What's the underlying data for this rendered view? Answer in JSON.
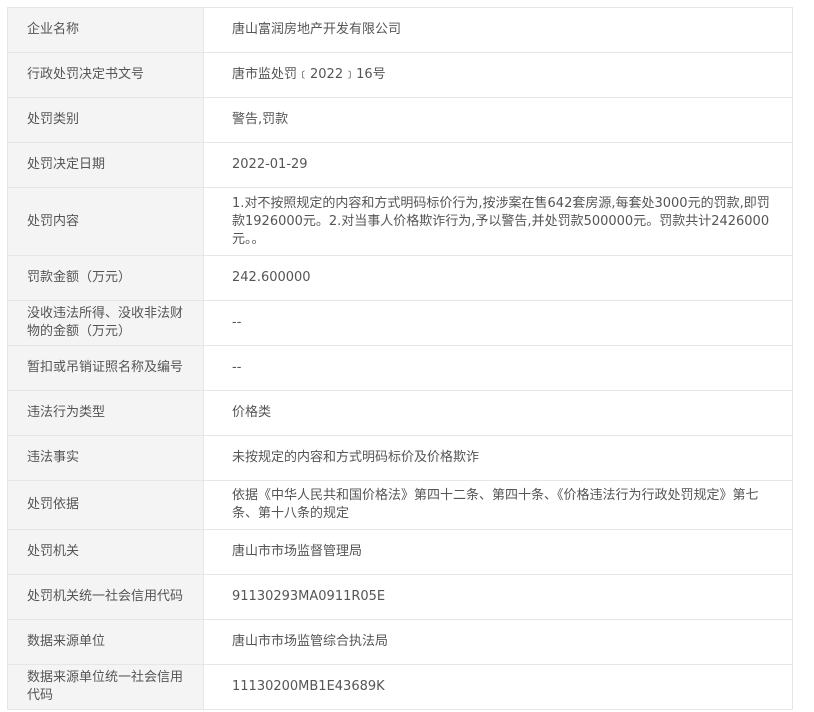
{
  "rows": [
    {
      "label": "企业名称",
      "value": "唐山富润房地产开发有限公司"
    },
    {
      "label": "行政处罚决定书文号",
      "value": "唐市监处罚﹝2022﹞16号"
    },
    {
      "label": "处罚类别",
      "value": "警告,罚款"
    },
    {
      "label": "处罚决定日期",
      "value": "2022-01-29"
    },
    {
      "label": "处罚内容",
      "value": "1.对不按照规定的内容和方式明码标价行为,按涉案在售642套房源,每套处3000元的罚款,即罚款1926000元。2.对当事人价格欺诈行为,予以警告,并处罚款500000元。罚款共计2426000元。。"
    },
    {
      "label": "罚款金额（万元）",
      "value": "242.600000"
    },
    {
      "label": "没收违法所得、没收非法财物的金额（万元）",
      "value": "--"
    },
    {
      "label": "暂扣或吊销证照名称及编号",
      "value": "--"
    },
    {
      "label": "违法行为类型",
      "value": "价格类"
    },
    {
      "label": "违法事实",
      "value": "未按规定的内容和方式明码标价及价格欺诈"
    },
    {
      "label": "处罚依据",
      "value": "依据《中华人民共和国价格法》第四十二条、第四十条、《价格违法行为行政处罚规定》第七条、第十八条的规定"
    },
    {
      "label": "处罚机关",
      "value": "唐山市市场监督管理局"
    },
    {
      "label": "处罚机关统一社会信用代码",
      "value": "91130293MA0911R05E"
    },
    {
      "label": "数据来源单位",
      "value": "唐山市市场监管综合执法局"
    },
    {
      "label": "数据来源单位统一社会信用代码",
      "value": "11130200MB1E43689K"
    }
  ]
}
